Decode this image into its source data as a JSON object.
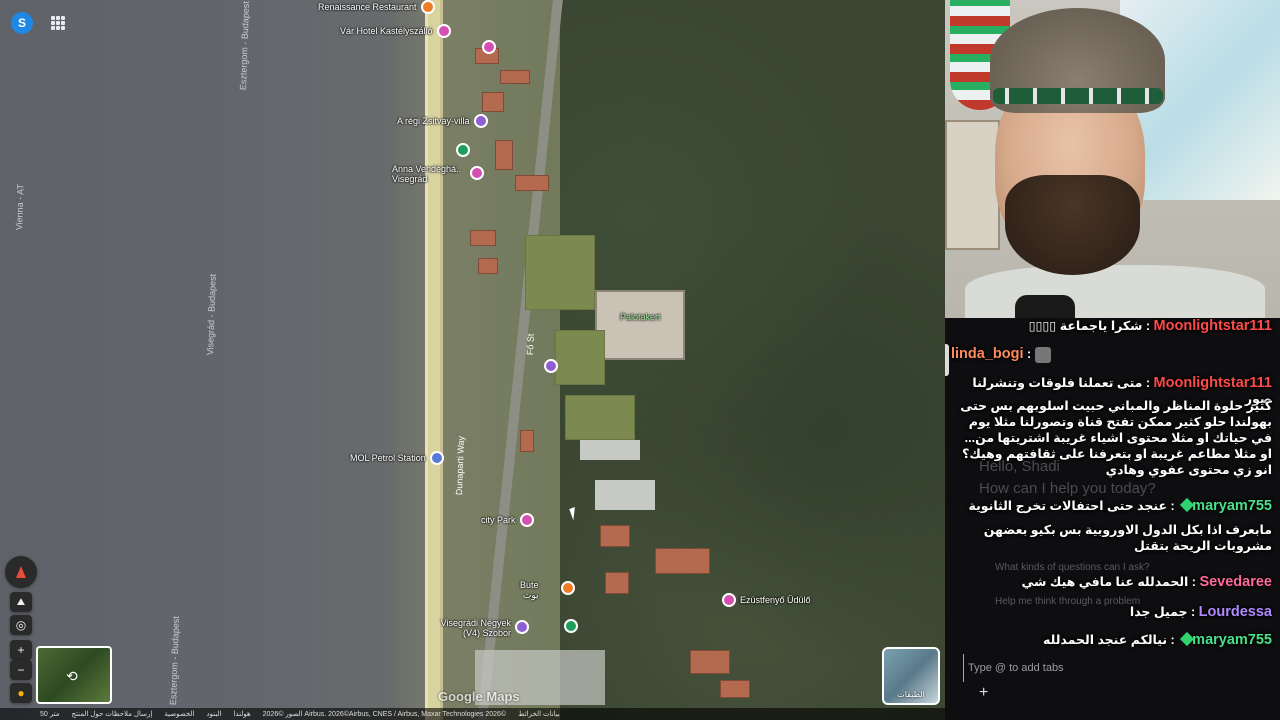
{
  "map": {
    "labels": {
      "renaissance": "Renaissance Restaurant",
      "var_hotel": "Vár Hotel Kastélyszálló",
      "zsitvay": "A régi Zsitvay-villa",
      "anna": "Anna Vendéghá.. Visegrád",
      "palotakert": "Palotakert",
      "fo_st": "Fő St",
      "mol": "MOL Petrol Station",
      "city_park": "city Park",
      "bute": "Bute",
      "bute_ar": "بوت",
      "negyek": "Visegrádi Négyek (V4) Szobor",
      "ezust": "Ezüstfenyő Üdülő",
      "esztergom_top": "Esztergom - Budapest",
      "visegrad_river": "Visegrád - Budapest",
      "vienna": "Vienna - AT",
      "dunaparti": "Dunaparti Way",
      "esztergom_bottom": "Esztergom - Budapest"
    },
    "controls": {
      "avatar_letter": "S",
      "zoom_in": "+",
      "zoom_out": "−",
      "layers_label": "الطبقات"
    },
    "google_maps": "Google Maps",
    "footer": {
      "scale": "50 متر",
      "items": [
        "إرسال ملاحظات حول المنتج",
        "الخصوصية",
        "البنود",
        "هولندا",
        "2026© الصور Airbus. 2026©Airbus, CNES / Airbus, Maxar Technologies 2026©",
        "بيانات الخرائط"
      ]
    }
  },
  "chat": {
    "ghost": {
      "hello": "Hello, Shadi",
      "help": "How can I help you today?",
      "q1": "What kinds of questions can I ask?",
      "q2": "Help me think through a problem",
      "input_placeholder": "Type @ to add tabs",
      "plus": "+"
    },
    "messages": [
      {
        "user": "Moonlightstar111",
        "sep": " : ",
        "text": "شكرا ياجماعة ▯▯▯▯"
      },
      {
        "user": "linda_bogi",
        "sep": " : ",
        "text": ""
      },
      {
        "user": "Moonlightstar111",
        "sep": " : ",
        "text": "متى تعملنا فلوقات وتنشرلنا صور"
      },
      {
        "user": "",
        "sep": "",
        "text": "كثير حلوة المناظر والمباني حبيت اسلوبهم بس حتى بهولندا حلو كثير ممكن تفتح قناة وتصورلنا مثلا يوم في حياتك او مثلا محتوى اشياء غريبة اشتريتها من... او مثلا مطاعم غريبة او بتعرفنا على ثقافتهم وهيك؟ انو زي محتوى عفوي وهادي"
      },
      {
        "user": "maryam755",
        "sep": " : ",
        "text": "عنجد حتى احتفالات تخرج الثانوية"
      },
      {
        "user": "",
        "sep": "",
        "text": "مابعرف اذا بكل الدول الاوروبية بس بكيو  بعضهن مشروبات الريحة بتقتل"
      },
      {
        "user": "Sevedaree",
        "sep": " : ",
        "text": "الحمدلله عنا مافي هيك شي"
      },
      {
        "user": "Lourdessa",
        "sep": " : ",
        "text": "جميل جدا"
      },
      {
        "user": "maryam755",
        "sep": " : ",
        "text": "نيالكم عنجد الحمدلله"
      }
    ]
  }
}
